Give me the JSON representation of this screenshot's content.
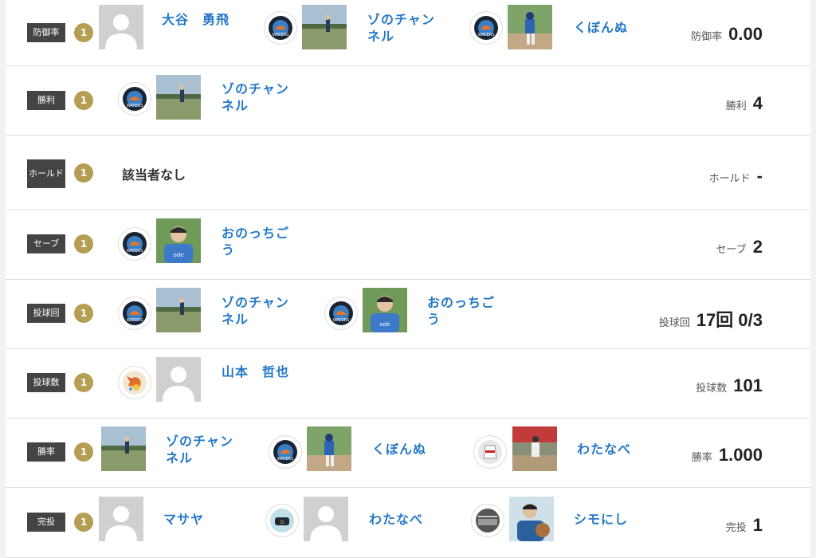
{
  "rows": [
    {
      "label": "防御率",
      "rank": "1",
      "players": [
        {
          "name": "大谷　勇飛"
        },
        {
          "name": "ゾのチャンネル"
        },
        {
          "name": "くぼんぬ"
        }
      ],
      "stat_label": "防御率",
      "stat_value": "0.00"
    },
    {
      "label": "勝利",
      "rank": "1",
      "players": [
        {
          "name": "ゾのチャンネル"
        }
      ],
      "stat_label": "勝利",
      "stat_value": "4"
    },
    {
      "label": "ホールド",
      "rank": "1",
      "none_text": "該当者なし",
      "stat_label": "ホールド",
      "stat_value": "-"
    },
    {
      "label": "セーブ",
      "rank": "1",
      "players": [
        {
          "name": "おのっちごう"
        }
      ],
      "stat_label": "セーブ",
      "stat_value": "2"
    },
    {
      "label": "投球回",
      "rank": "1",
      "players": [
        {
          "name": "ゾのチャンネル"
        },
        {
          "name": "おのっちごう"
        }
      ],
      "stat_label": "投球回",
      "stat_value": "17回 0/3"
    },
    {
      "label": "投球数",
      "rank": "1",
      "players": [
        {
          "name": "山本　哲也"
        }
      ],
      "stat_label": "投球数",
      "stat_value": "101"
    },
    {
      "label": "勝率",
      "rank": "1",
      "players": [
        {
          "name": "ゾのチャンネル"
        },
        {
          "name": "くぼんぬ"
        },
        {
          "name": "わたなべ"
        }
      ],
      "stat_label": "勝率",
      "stat_value": "1.000"
    },
    {
      "label": "完投",
      "rank": "1",
      "players": [
        {
          "name": "マサヤ"
        },
        {
          "name": "わたなべ"
        },
        {
          "name": "シモにし"
        }
      ],
      "stat_label": "完投",
      "stat_value": "1"
    }
  ],
  "colors": {
    "rank_badge": "#b59e53",
    "label_bg": "#444444",
    "player_link": "#2478c8"
  }
}
